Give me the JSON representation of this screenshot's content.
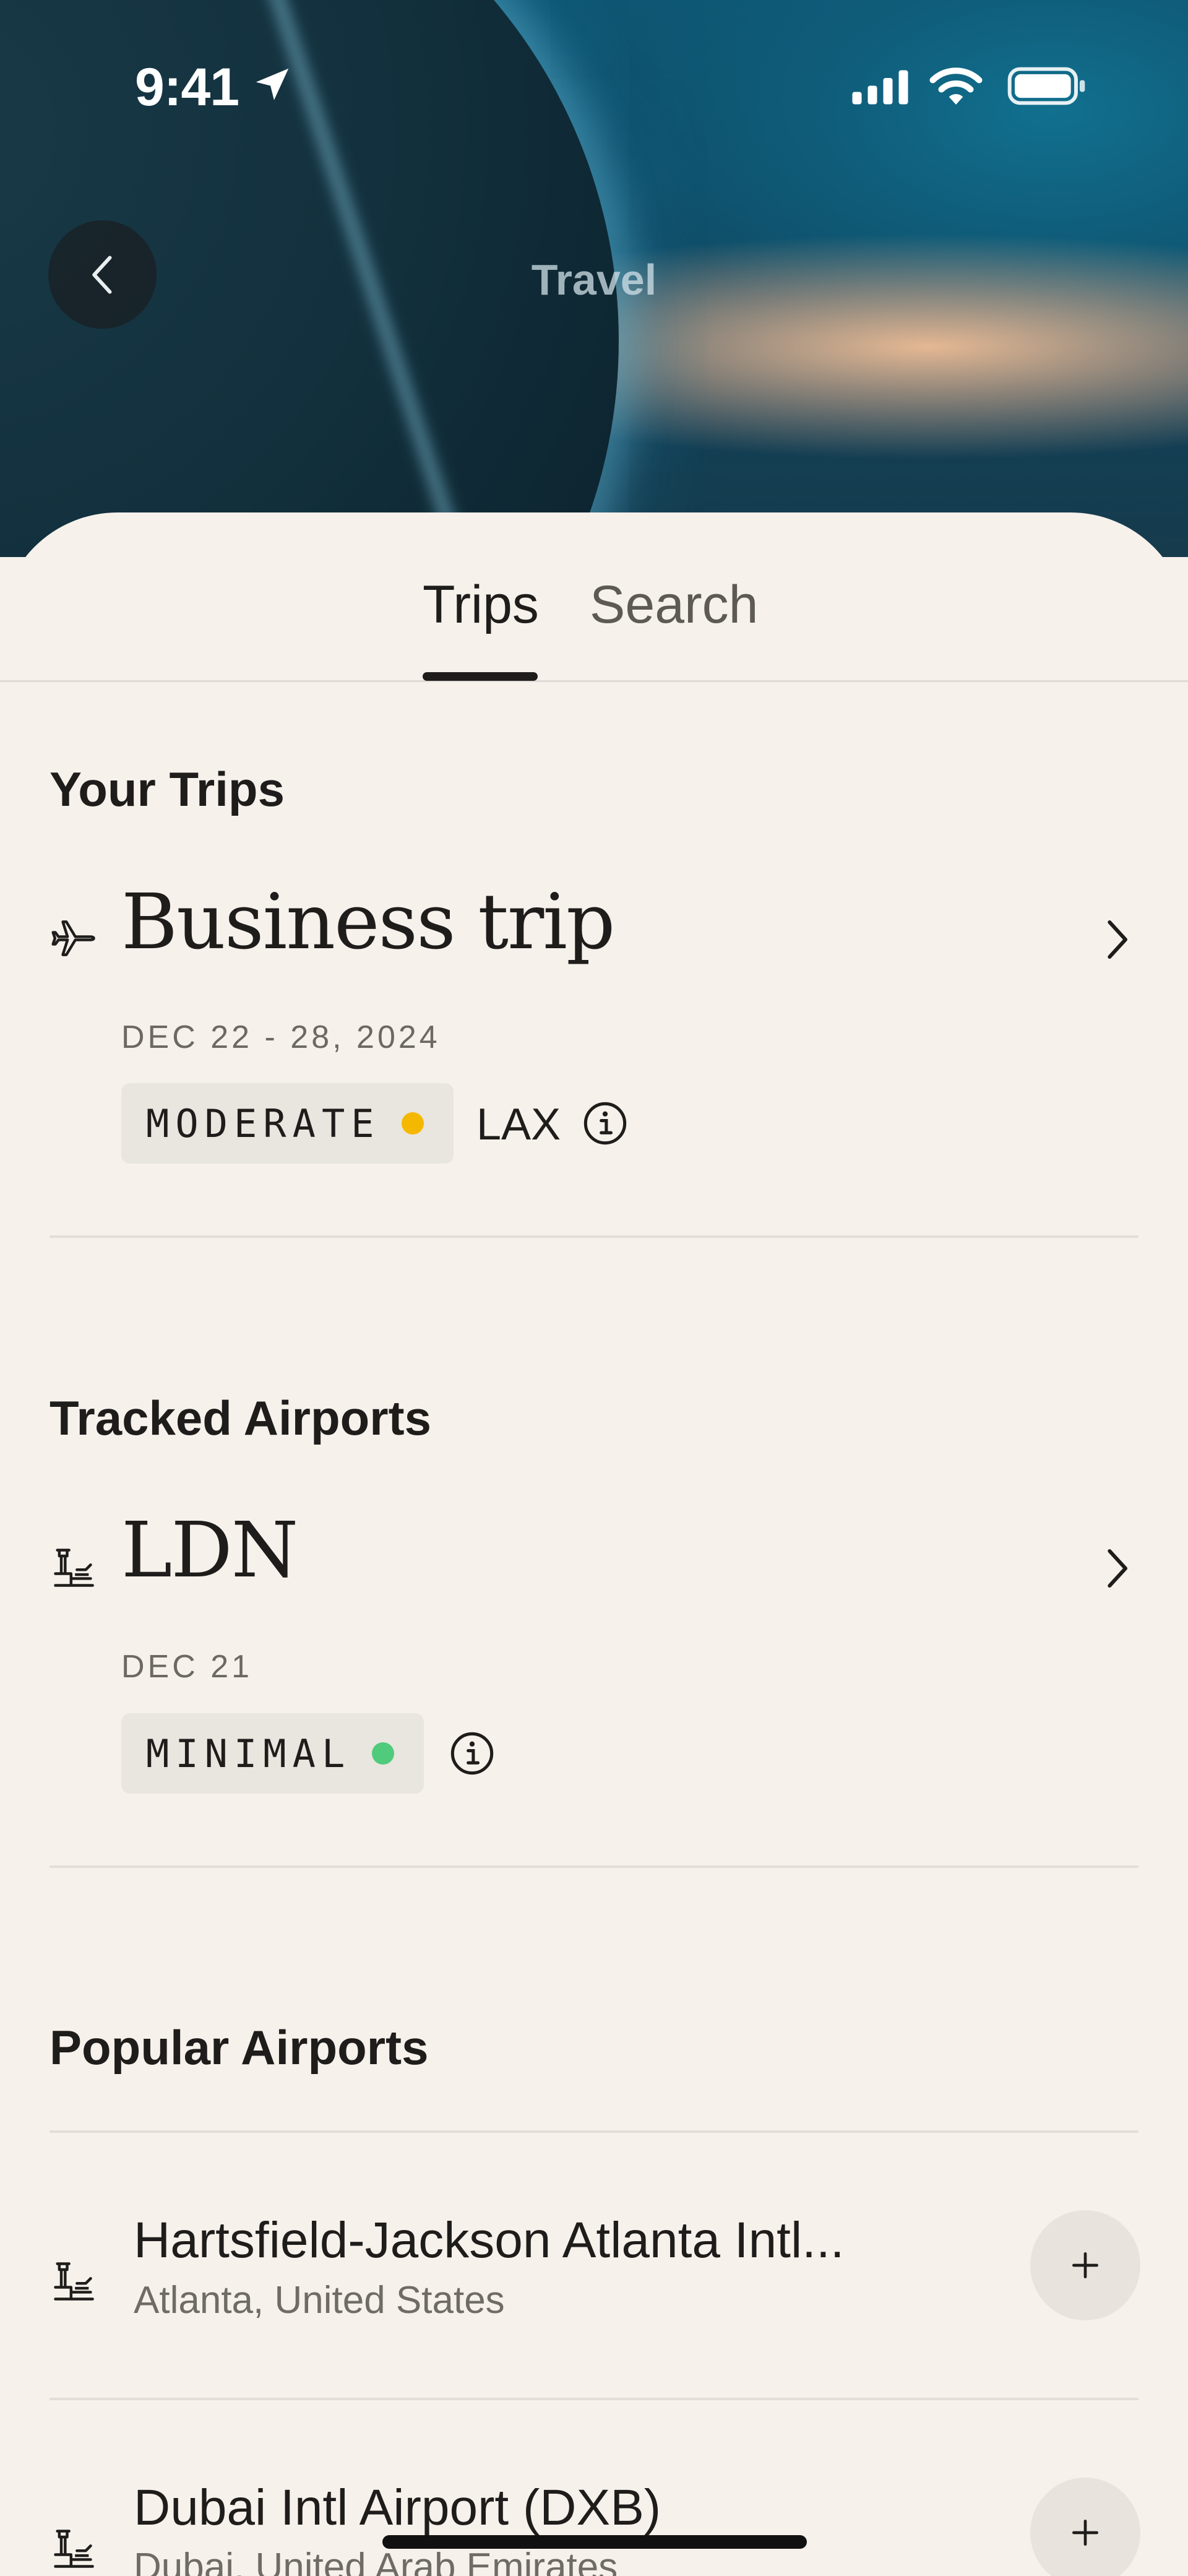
{
  "status_bar": {
    "time": "9:41"
  },
  "header": {
    "title": "Travel",
    "back_icon": "chevron-left-icon"
  },
  "tabs": [
    {
      "label": "Trips",
      "selected": true
    },
    {
      "label": "Search",
      "selected": false
    }
  ],
  "your_trips": {
    "heading": "Your Trips",
    "items": [
      {
        "icon": "airplane-icon",
        "title": "Business trip",
        "dates": "DEC 22 - 28, 2024",
        "status": "MODERATE",
        "status_color": "#f5b800",
        "airport": "LAX"
      }
    ]
  },
  "tracked_airports": {
    "heading": "Tracked Airports",
    "items": [
      {
        "icon": "airport-tower-icon",
        "title": "LDN",
        "dates": "DEC 21",
        "status": "MINIMAL",
        "status_color": "#4fcb7b"
      }
    ]
  },
  "popular_airports": {
    "heading": "Popular Airports",
    "items": [
      {
        "name": "Hartsfield-Jackson Atlanta Intl...",
        "location": "Atlanta, United States"
      },
      {
        "name": "Dubai Intl Airport (DXB)",
        "location": "Dubai, United Arab Emirates"
      }
    ]
  }
}
